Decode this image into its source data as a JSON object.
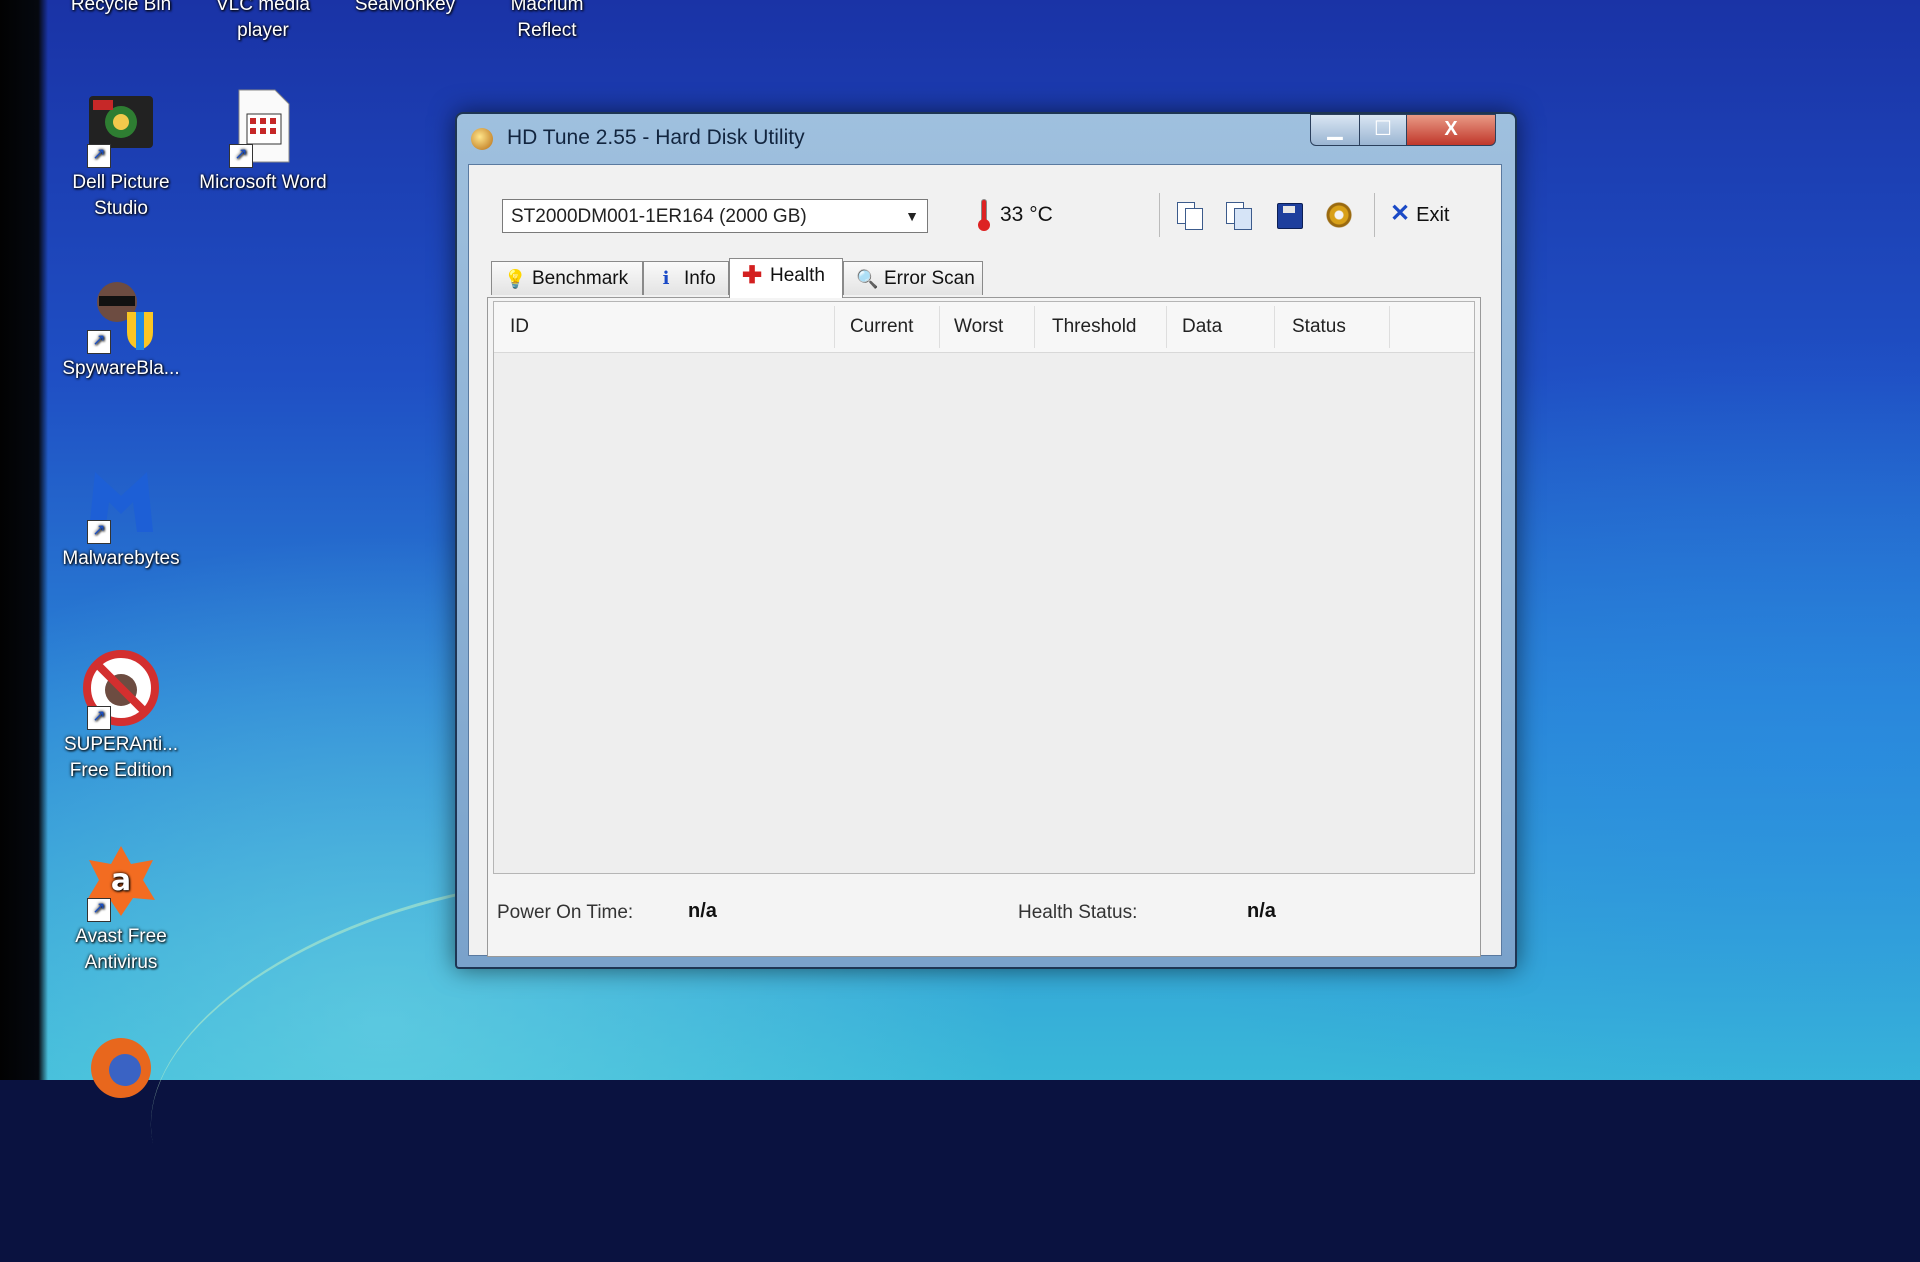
{
  "desktop": {
    "top_labels": [
      "Recycle Bin",
      "VLC media player",
      "SeaMonkey",
      "Macrium Reflect"
    ],
    "icons": [
      {
        "label": "Dell Picture Studio",
        "icon": "dell-picture-studio-icon"
      },
      {
        "label": "Microsoft Word",
        "icon": "word-document-icon"
      },
      {
        "label": "SpywareBla...",
        "icon": "spywareblaster-icon"
      },
      {
        "label": "Malwarebytes",
        "icon": "malwarebytes-icon"
      },
      {
        "label": "SUPERAnti... Free Edition",
        "icon": "superantispyware-icon"
      },
      {
        "label": "Avast Free Antivirus",
        "icon": "avast-icon"
      }
    ]
  },
  "window": {
    "title": "HD Tune 2.55 - Hard Disk Utility",
    "controls": {
      "minimize": "▁",
      "maximize": "☐",
      "close": "X"
    }
  },
  "toolbar": {
    "drive": "ST2000DM001-1ER164 (2000 GB)",
    "temperature": "33 °C",
    "buttons": [
      "copy-text-icon",
      "copy-screenshot-icon",
      "save-icon",
      "options-icon"
    ],
    "exit_label": "Exit"
  },
  "tabs": [
    {
      "label": "Benchmark",
      "icon": "lightbulb-icon",
      "active": false
    },
    {
      "label": "Info",
      "icon": "info-icon",
      "active": false
    },
    {
      "label": "Health",
      "icon": "health-cross-icon",
      "active": true
    },
    {
      "label": "Error Scan",
      "icon": "magnifier-icon",
      "active": false
    }
  ],
  "health_table": {
    "columns": [
      "ID",
      "Current",
      "Worst",
      "Threshold",
      "Data",
      "Status"
    ],
    "rows": []
  },
  "status": {
    "power_on_time_label": "Power On Time:",
    "power_on_time_value": "n/a",
    "health_status_label": "Health Status:",
    "health_status_value": "n/a"
  },
  "colors": {
    "close_button": "#c0372a",
    "window_frame": "#7aa2cb",
    "exit_x": "#1a49c6"
  }
}
